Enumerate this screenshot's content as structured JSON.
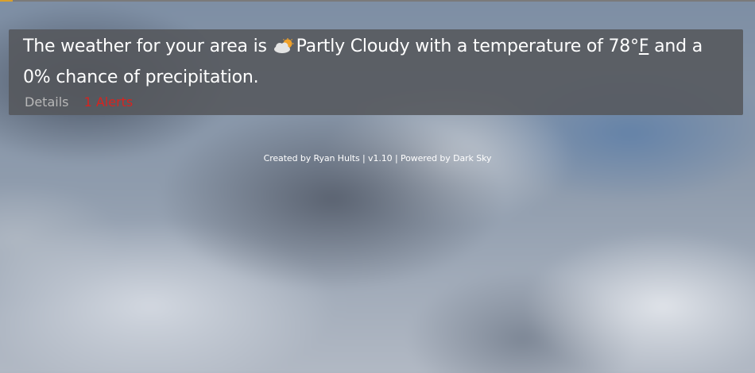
{
  "weather": {
    "text_before_icon": "The weather for your area is",
    "icon": "partly-cloudy-day-icon",
    "condition": "Partly Cloudy",
    "text_temp": "with a temperature of",
    "temperature": "78°",
    "unit": "F",
    "text_chance_before": "and a",
    "precip": "0%",
    "text_chance_after": "chance of precipitation."
  },
  "links": {
    "details": "Details",
    "alerts": "1 Alerts"
  },
  "footer": {
    "text": "Created by Ryan Hults | v1.10 | Powered by Dark Sky"
  },
  "colors": {
    "panel": "#55585c",
    "text": "#ffffff",
    "details": "#b8b8b8",
    "alerts": "#d8231f",
    "accent": "#d9a02b"
  }
}
